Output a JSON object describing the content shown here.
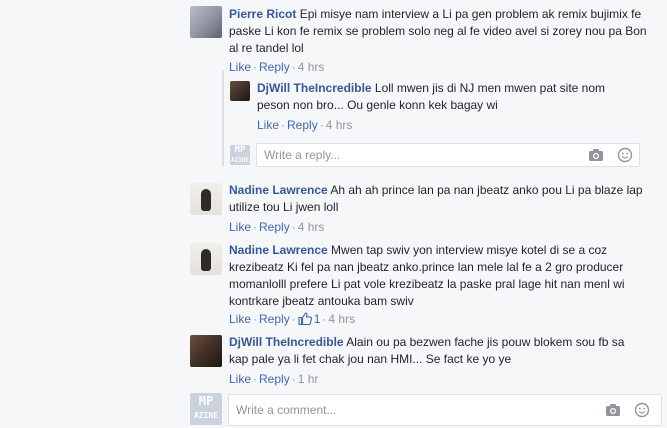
{
  "comments": [
    {
      "author": "Pierre Ricot",
      "text_lines": [
        "Epi misye nam interview a Li pa gen problem ak remix bujimix fe",
        "paske Li kon fe remix se problem solo neg al fe video avel si zorey nou pa Bon",
        "al re tandel lol"
      ],
      "like_label": "Like",
      "reply_label": "Reply",
      "time": "4 hrs"
    },
    {
      "author": "DjWill TheIncredible",
      "text_lines": [
        "Loll mwen jis di NJ men mwen pat site nom",
        "peson non bro... Ou genle konn kek bagay wi"
      ],
      "like_label": "Like",
      "reply_label": "Reply",
      "time": "4 hrs"
    },
    {
      "author": "Nadine Lawrence",
      "text_lines": [
        "Ah ah ah prince lan pa nan jbeatz anko pou Li pa blaze lap",
        "utilize tou Li jwen loll"
      ],
      "like_label": "Like",
      "reply_label": "Reply",
      "time": "4 hrs"
    },
    {
      "author": "Nadine Lawrence",
      "text_lines": [
        "Mwen tap swiv yon interview misye kotel di se a coz",
        "krezibeatz Ki fel pa nan jbeatz anko.prince lan mele lal fe a 2 gro producer",
        "momanlolll prefere Li pat vole krezibeatz la paske pral lage hit nan menl wi",
        "kontrkare jbeatz antouka bam swiv"
      ],
      "like_label": "Like",
      "reply_label": "Reply",
      "like_count": "1",
      "time": "4 hrs"
    },
    {
      "author": "DjWill TheIncredible",
      "text_lines": [
        "Alain ou pa bezwen fache jis pouw blokem sou fb sa",
        "kap pale ya li fet chak jou nan HMI... Se fact ke yo ye"
      ],
      "like_label": "Like",
      "reply_label": "Reply",
      "time": "1 hr"
    }
  ],
  "reply_input": {
    "placeholder": "Write a reply..."
  },
  "comment_input": {
    "placeholder": "Write a comment..."
  },
  "icons": {
    "camera": "camera-icon",
    "emoji": "emoji-icon",
    "like": "thumbs-up-icon"
  },
  "avatar_text": {
    "line1": "MP",
    "line2": "AZINE"
  },
  "colors": {
    "author": "#365899",
    "link": "#4267b2",
    "muted": "#90949c"
  }
}
